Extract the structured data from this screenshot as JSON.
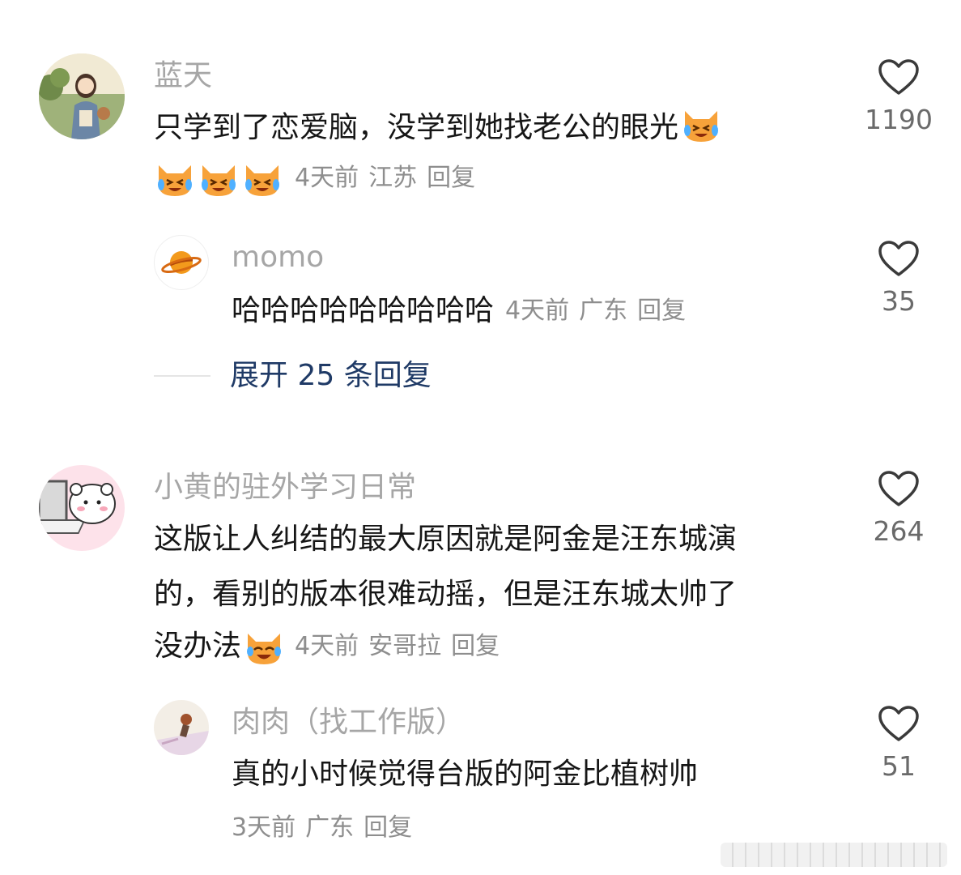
{
  "comments": [
    {
      "author": "蓝天",
      "text": "只学到了恋爱脑，没学到她找老公的眼光",
      "emoji": "crying-laughing-cat-emoji",
      "time": "4天前",
      "location": "江苏",
      "reply_label": "回复",
      "likes": "1190",
      "replies": [
        {
          "author": "momo",
          "text": "哈哈哈哈哈哈哈哈哈",
          "time": "4天前",
          "location": "广东",
          "reply_label": "回复",
          "likes": "35"
        }
      ],
      "expand_label": "展开 25 条回复"
    },
    {
      "author": "小黄的驻外学习日常",
      "text_line1": "这版让人纠结的最大原因就是阿金是汪东城演",
      "text_line2": "的，看别的版本很难动摇，但是汪东城太帅了",
      "text_line3": "没办法",
      "emoji": "laughing-cat-emoji",
      "time": "4天前",
      "location": "安哥拉",
      "reply_label": "回复",
      "likes": "264",
      "replies": [
        {
          "author": "肉肉（找工作版）",
          "text": "真的小时候觉得台版的阿金比植树帅",
          "time": "3天前",
          "location": "广东",
          "reply_label": "回复",
          "likes": "51"
        }
      ]
    }
  ],
  "colors": {
    "author": "#a6a6a6",
    "text": "#161616",
    "meta": "#8e8e8e",
    "expand": "#1f3a66",
    "heart": "#3a3a3a"
  },
  "icons": {
    "like": "heart-outline-icon",
    "planet": "planet-icon"
  }
}
